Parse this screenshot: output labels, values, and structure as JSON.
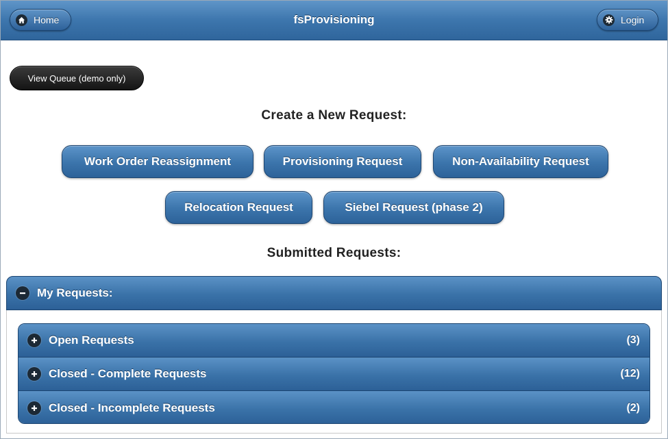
{
  "header": {
    "title": "fsProvisioning",
    "home_label": "Home",
    "login_label": "Login"
  },
  "queue_button_label": "View Queue (demo only)",
  "create_heading": "Create a New Request:",
  "request_buttons": [
    "Work Order Reassignment",
    "Provisioning Request",
    "Non-Availability Request",
    "Relocation Request",
    "Siebel Request (phase 2)"
  ],
  "submitted_heading": "Submitted Requests:",
  "my_requests": {
    "label": "My Requests:",
    "items": [
      {
        "label": "Open Requests",
        "count": "(3)"
      },
      {
        "label": "Closed - Complete Requests",
        "count": "(12)"
      },
      {
        "label": "Closed - Incomplete Requests",
        "count": "(2)"
      }
    ]
  },
  "colors": {
    "bar_blue": "#3a72a8",
    "dark_button": "#1f1f1f"
  },
  "icons": {
    "home": "home-icon",
    "login": "gear-icon",
    "collapse": "minus-icon",
    "expand": "plus-icon"
  }
}
